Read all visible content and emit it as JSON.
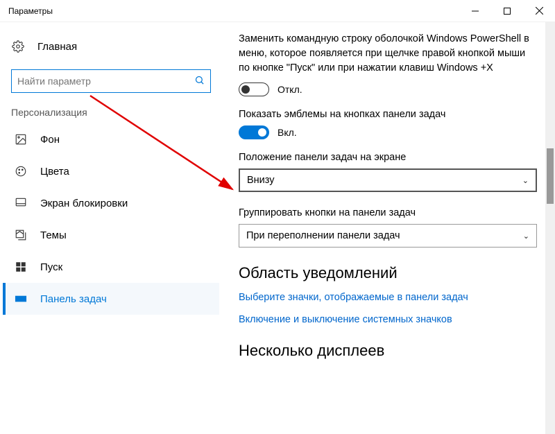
{
  "window": {
    "title": "Параметры"
  },
  "sidebar": {
    "home": "Главная",
    "search_placeholder": "Найти параметр",
    "category": "Персонализация",
    "items": [
      {
        "label": "Фон"
      },
      {
        "label": "Цвета"
      },
      {
        "label": "Экран блокировки"
      },
      {
        "label": "Темы"
      },
      {
        "label": "Пуск"
      },
      {
        "label": "Панель задач"
      }
    ]
  },
  "content": {
    "powershell_desc": "Заменить командную строку оболочкой Windows PowerShell в меню, которое появляется при щелчке правой кнопкой мыши по кнопке \"Пуск\" или при нажатии клавиш Windows +X",
    "toggle_off": "Откл.",
    "badges_label": "Показать эмблемы на кнопках панели задач",
    "toggle_on": "Вкл.",
    "position_label": "Положение панели задач на экране",
    "position_value": "Внизу",
    "group_label": "Группировать кнопки на панели задач",
    "group_value": "При переполнении панели задач",
    "notif_heading": "Область уведомлений",
    "link_icons": "Выберите значки, отображаемые в панели задач",
    "link_system": "Включение и выключение системных значков",
    "displays_heading": "Несколько дисплеев"
  }
}
